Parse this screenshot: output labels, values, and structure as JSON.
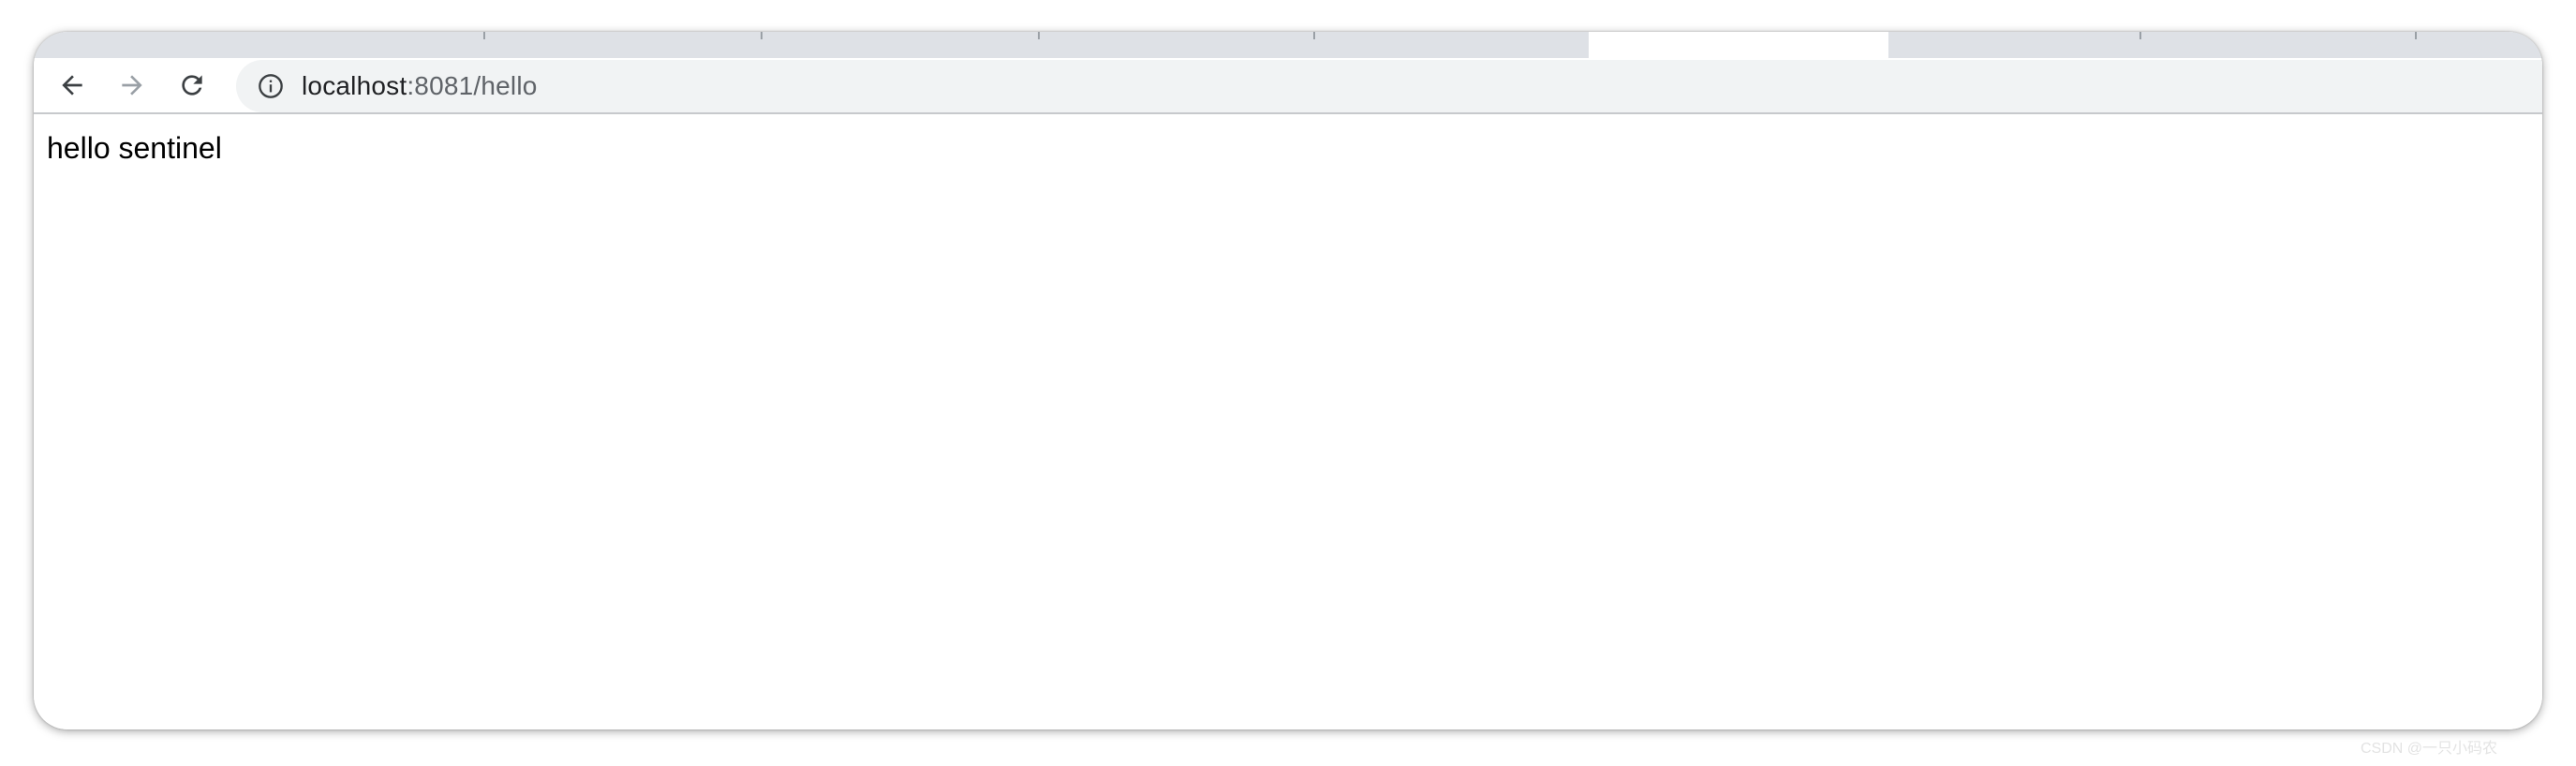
{
  "browser": {
    "tabs_count": 9,
    "active_tab_index": 5,
    "address": {
      "host": "localhost",
      "rest": ":8081/hello"
    }
  },
  "page": {
    "body_text": "hello sentinel"
  },
  "watermark": "CSDN @一只小码农"
}
